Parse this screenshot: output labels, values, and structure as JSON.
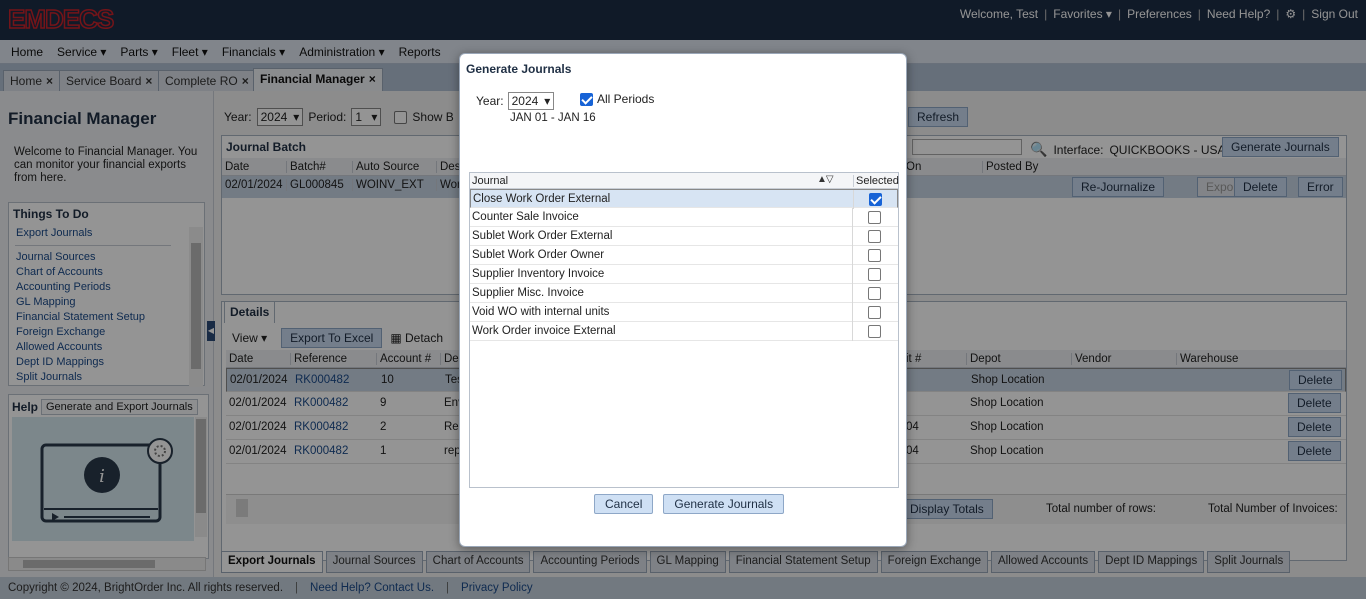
{
  "app": {
    "logo": "EMDECS"
  },
  "topbar": {
    "welcome": "Welcome, Test",
    "favorites": "Favorites",
    "preferences": "Preferences",
    "help": "Need Help?",
    "signout": "Sign Out"
  },
  "menu": [
    "Home",
    "Service",
    "Parts",
    "Fleet",
    "Financials",
    "Administration",
    "Reports"
  ],
  "tabs": [
    {
      "label": "Home"
    },
    {
      "label": "Service Board"
    },
    {
      "label": "Complete RO"
    },
    {
      "label": "Financial Manager"
    }
  ],
  "left": {
    "title": "Financial Manager",
    "welcome": "Welcome to Financial Manager. You can monitor your financial exports from here.",
    "things_title": "Things To Do",
    "links": [
      "Export Journals",
      "Journal Sources",
      "Chart of Accounts",
      "Accounting Periods",
      "GL Mapping",
      "Financial Statement Setup",
      "Foreign Exchange",
      "Allowed Accounts",
      "Dept ID Mappings",
      "Split Journals"
    ],
    "help_title": "Help",
    "help_tab": "Generate and Export Journals"
  },
  "filter": {
    "year_label": "Year:",
    "year": "2024",
    "period_label": "Period:",
    "period": "1",
    "show_label": "Show B",
    "refresh": "Refresh"
  },
  "journal_batch": {
    "title": "Journal Batch",
    "interface_label": "Interface:",
    "interface": "QUICKBOOKS - USA",
    "generate": "Generate Journals",
    "headers": [
      "Date",
      "Batch#",
      "Auto Source",
      "Desc",
      "On",
      "Posted By"
    ],
    "row": {
      "date": "02/01/2024",
      "batch": "GL000845",
      "source": "WOINV_EXT",
      "desc": "Wor"
    },
    "buttons": {
      "rejournalize": "Re-Journalize",
      "export": "Export",
      "delete": "Delete",
      "error": "Error"
    }
  },
  "details": {
    "tab": "Details",
    "view": "View",
    "export_excel": "Export To Excel",
    "detach": "Detach",
    "headers": [
      "Date",
      "Reference",
      "Account #",
      "Des",
      "it #",
      "Depot",
      "Vendor",
      "Warehouse"
    ],
    "rows": [
      {
        "date": "02/01/2024",
        "ref": "RK000482",
        "acct": "10",
        "desc": "Tes",
        "unit": "",
        "depot": "Shop Location"
      },
      {
        "date": "02/01/2024",
        "ref": "RK000482",
        "acct": "9",
        "desc": "Env",
        "unit": "",
        "depot": "Shop Location"
      },
      {
        "date": "02/01/2024",
        "ref": "RK000482",
        "acct": "2",
        "desc": "Rer",
        "unit": "04",
        "depot": "Shop Location"
      },
      {
        "date": "02/01/2024",
        "ref": "RK000482",
        "acct": "1",
        "desc": "rep",
        "unit": "04",
        "depot": "Shop Location"
      }
    ],
    "delete": "Delete",
    "display_totals": "Display Totals",
    "total_rows": "Total number of rows:",
    "total_invoices": "Total Number of Invoices:"
  },
  "bottom_tabs": [
    "Export Journals",
    "Journal Sources",
    "Chart of Accounts",
    "Accounting Periods",
    "GL Mapping",
    "Financial Statement Setup",
    "Foreign Exchange",
    "Allowed Accounts",
    "Dept ID Mappings",
    "Split Journals"
  ],
  "footer": {
    "copyright": "Copyright © 2024, BrightOrder Inc. All rights reserved.",
    "contact": "Need Help? Contact Us.",
    "privacy": "Privacy Policy"
  },
  "modal": {
    "title": "Generate Journals",
    "year_label": "Year:",
    "year": "2024",
    "all_periods": "All Periods",
    "range": "JAN 01 - JAN 16",
    "col_journal": "Journal",
    "col_selected": "Selected",
    "journals": [
      {
        "name": "Close Work Order External",
        "selected": true
      },
      {
        "name": "Counter Sale Invoice",
        "selected": false
      },
      {
        "name": "Sublet Work Order External",
        "selected": false
      },
      {
        "name": "Sublet Work Order Owner",
        "selected": false
      },
      {
        "name": "Supplier Inventory Invoice",
        "selected": false
      },
      {
        "name": "Supplier Misc. Invoice",
        "selected": false
      },
      {
        "name": "Void WO with internal units",
        "selected": false
      },
      {
        "name": "Work Order invoice External",
        "selected": false
      }
    ],
    "cancel": "Cancel",
    "generate": "Generate Journals"
  }
}
